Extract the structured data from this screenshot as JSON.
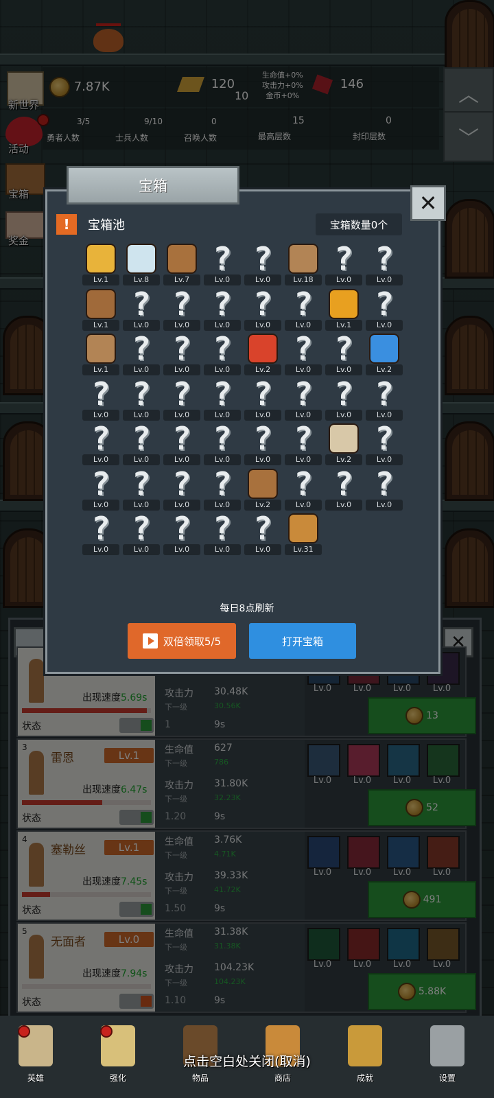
{
  "hud": {
    "world_label": "新世界",
    "activity_label": "活动",
    "chest_label": "宝箱",
    "reward_label": "奖金",
    "coins": "7.87K",
    "gold_bars": "120",
    "gold_bar_sub": "10",
    "gems": "146",
    "bonus_hp": "生命值+0%",
    "bonus_atk": "攻击力+0%",
    "bonus_gold": "金币+0%",
    "heroes_count": "3/5",
    "heroes_label": "勇者人数",
    "soldiers_count": "9/10",
    "soldiers_label": "士兵人数",
    "summon_count": "0",
    "summon_label": "召唤人数",
    "max_floor": "15",
    "max_floor_label": "最高层数",
    "sealed_floor": "0",
    "sealed_floor_label": "封印层数"
  },
  "modal": {
    "title": "宝箱",
    "pool_title": "宝箱池",
    "chest_count": "宝箱数量0个",
    "refresh_text": "每日8点刷新",
    "double_claim_label": "双倍领取5/5",
    "open_label": "打开宝箱"
  },
  "grid_items": [
    {
      "icon": "crown-icon",
      "lv": "Lv.1",
      "known": true,
      "color": "#e8b33a"
    },
    {
      "icon": "diamond-icon",
      "lv": "Lv.8",
      "known": true,
      "color": "#cfe4ee"
    },
    {
      "icon": "backpack-icon",
      "lv": "Lv.7",
      "known": true,
      "color": "#a8713d"
    },
    {
      "icon": "unknown-icon",
      "lv": "Lv.0",
      "known": false
    },
    {
      "icon": "unknown-icon",
      "lv": "Lv.0",
      "known": false
    },
    {
      "icon": "sword-icon",
      "lv": "Lv.18",
      "known": true,
      "color": "#b28455"
    },
    {
      "icon": "unknown-icon",
      "lv": "Lv.0",
      "known": false
    },
    {
      "icon": "unknown-icon",
      "lv": "Lv.0",
      "known": false
    },
    {
      "icon": "boot-icon",
      "lv": "Lv.1",
      "known": true,
      "color": "#a06a3a"
    },
    {
      "icon": "unknown-icon",
      "lv": "Lv.0",
      "known": false
    },
    {
      "icon": "unknown-icon",
      "lv": "Lv.0",
      "known": false
    },
    {
      "icon": "unknown-icon",
      "lv": "Lv.0",
      "known": false
    },
    {
      "icon": "unknown-icon",
      "lv": "Lv.0",
      "known": false
    },
    {
      "icon": "unknown-icon",
      "lv": "Lv.0",
      "known": false
    },
    {
      "icon": "torch-icon",
      "lv": "Lv.1",
      "known": true,
      "color": "#e8a020"
    },
    {
      "icon": "unknown-icon",
      "lv": "Lv.0",
      "known": false
    },
    {
      "icon": "dagger-icon",
      "lv": "Lv.1",
      "known": true,
      "color": "#b28455"
    },
    {
      "icon": "unknown-icon",
      "lv": "Lv.0",
      "known": false
    },
    {
      "icon": "unknown-icon",
      "lv": "Lv.0",
      "known": false
    },
    {
      "icon": "unknown-icon",
      "lv": "Lv.0",
      "known": false
    },
    {
      "icon": "red-potion-icon",
      "lv": "Lv.2",
      "known": true,
      "color": "#d9432b"
    },
    {
      "icon": "unknown-icon",
      "lv": "Lv.0",
      "known": false
    },
    {
      "icon": "unknown-icon",
      "lv": "Lv.0",
      "known": false
    },
    {
      "icon": "blue-potion-icon",
      "lv": "Lv.2",
      "known": true,
      "color": "#3a8fe0"
    },
    {
      "icon": "unknown-icon",
      "lv": "Lv.0",
      "known": false
    },
    {
      "icon": "unknown-icon",
      "lv": "Lv.0",
      "known": false
    },
    {
      "icon": "unknown-icon",
      "lv": "Lv.0",
      "known": false
    },
    {
      "icon": "unknown-icon",
      "lv": "Lv.0",
      "known": false
    },
    {
      "icon": "unknown-icon",
      "lv": "Lv.0",
      "known": false
    },
    {
      "icon": "unknown-icon",
      "lv": "Lv.0",
      "known": false
    },
    {
      "icon": "unknown-icon",
      "lv": "Lv.0",
      "known": false
    },
    {
      "icon": "unknown-icon",
      "lv": "Lv.0",
      "known": false
    },
    {
      "icon": "unknown-icon",
      "lv": "Lv.0",
      "known": false
    },
    {
      "icon": "unknown-icon",
      "lv": "Lv.0",
      "known": false
    },
    {
      "icon": "unknown-icon",
      "lv": "Lv.0",
      "known": false
    },
    {
      "icon": "unknown-icon",
      "lv": "Lv.0",
      "known": false
    },
    {
      "icon": "unknown-icon",
      "lv": "Lv.0",
      "known": false
    },
    {
      "icon": "unknown-icon",
      "lv": "Lv.0",
      "known": false
    },
    {
      "icon": "bread-icon",
      "lv": "Lv.2",
      "known": true,
      "color": "#d8c8a8"
    },
    {
      "icon": "unknown-icon",
      "lv": "Lv.0",
      "known": false
    },
    {
      "icon": "unknown-icon",
      "lv": "Lv.0",
      "known": false
    },
    {
      "icon": "unknown-icon",
      "lv": "Lv.0",
      "known": false
    },
    {
      "icon": "unknown-icon",
      "lv": "Lv.0",
      "known": false
    },
    {
      "icon": "unknown-icon",
      "lv": "Lv.0",
      "known": false
    },
    {
      "icon": "leather-armor-icon",
      "lv": "Lv.2",
      "known": true,
      "color": "#a8713d"
    },
    {
      "icon": "unknown-icon",
      "lv": "Lv.0",
      "known": false
    },
    {
      "icon": "unknown-icon",
      "lv": "Lv.0",
      "known": false
    },
    {
      "icon": "unknown-icon",
      "lv": "Lv.0",
      "known": false
    },
    {
      "icon": "unknown-icon",
      "lv": "Lv.0",
      "known": false
    },
    {
      "icon": "unknown-icon",
      "lv": "Lv.0",
      "known": false
    },
    {
      "icon": "unknown-icon",
      "lv": "Lv.0",
      "known": false
    },
    {
      "icon": "unknown-icon",
      "lv": "Lv.0",
      "known": false
    },
    {
      "icon": "unknown-icon",
      "lv": "Lv.0",
      "known": false
    },
    {
      "icon": "beer-mug-icon",
      "lv": "Lv.31",
      "known": true,
      "color": "#c98a3a"
    }
  ],
  "heroes": [
    {
      "index": "",
      "name": "",
      "level": "",
      "speed_label": "出现速度",
      "speed": "5.69s",
      "hp_fraction": 0.97,
      "status_label": "状态",
      "toggle_on": true,
      "hp_label": "",
      "hp": "",
      "hp_next_label": "",
      "hp_next": "",
      "atk_label": "攻击力",
      "atk": "30.48K",
      "atk_next_label": "下一级",
      "atk_next": "30.56K",
      "rate": "1",
      "time": "9s",
      "skills": [
        {
          "lv": "Lv.0",
          "color": "#2a4a6a"
        },
        {
          "lv": "Lv.0",
          "color": "#7a2a3a"
        },
        {
          "lv": "Lv.0",
          "color": "#2a4a6a"
        },
        {
          "lv": "Lv.0",
          "color": "#3a2a4a"
        }
      ],
      "cost": "13"
    },
    {
      "index": "3",
      "name": "雷恩",
      "level": "Lv.1",
      "speed_label": "出现速度",
      "speed": "6.47s",
      "hp_fraction": 0.62,
      "status_label": "状态",
      "toggle_on": true,
      "hp_label": "生命值",
      "hp": "627",
      "hp_next_label": "下一级",
      "hp_next": "786",
      "atk_label": "攻击力",
      "atk": "31.80K",
      "atk_next_label": "下一级",
      "atk_next": "32.23K",
      "rate": "1.20",
      "time": "9s",
      "skills": [
        {
          "lv": "Lv.0",
          "color": "#3a5a7a"
        },
        {
          "lv": "Lv.0",
          "color": "#b03a5a"
        },
        {
          "lv": "Lv.0",
          "color": "#2a6a8a"
        },
        {
          "lv": "Lv.0",
          "color": "#2a6a3a"
        }
      ],
      "cost": "52"
    },
    {
      "index": "4",
      "name": "塞勒丝",
      "level": "Lv.1",
      "speed_label": "出现速度",
      "speed": "7.45s",
      "hp_fraction": 0.22,
      "status_label": "状态",
      "toggle_on": true,
      "hp_label": "生命值",
      "hp": "3.76K",
      "hp_next_label": "下一级",
      "hp_next": "4.71K",
      "atk_label": "攻击力",
      "atk": "39.33K",
      "atk_next_label": "下一级",
      "atk_next": "41.72K",
      "rate": "1.50",
      "time": "9s",
      "skills": [
        {
          "lv": "Lv.0",
          "color": "#2a4a7a"
        },
        {
          "lv": "Lv.0",
          "color": "#8a2a3a"
        },
        {
          "lv": "Lv.0",
          "color": "#2a5a8a"
        },
        {
          "lv": "Lv.0",
          "color": "#8a3a2a"
        }
      ],
      "cost": "491"
    },
    {
      "index": "5",
      "name": "无面者",
      "level": "Lv.0",
      "speed_label": "出现速度",
      "speed": "7.94s",
      "hp_fraction": 0,
      "status_label": "状态",
      "toggle_on": false,
      "hp_label": "生命值",
      "hp": "31.38K",
      "hp_next_label": "下一级",
      "hp_next": "31.38K",
      "atk_label": "攻击力",
      "atk": "104.23K",
      "atk_next_label": "下一级",
      "atk_next": "104.23K",
      "rate": "1.10",
      "time": "9s",
      "skills": [
        {
          "lv": "Lv.0",
          "color": "#1f5a3a"
        },
        {
          "lv": "Lv.0",
          "color": "#8a2a2a"
        },
        {
          "lv": "Lv.0",
          "color": "#1f6a8a"
        },
        {
          "lv": "Lv.0",
          "color": "#7a5a2a"
        }
      ],
      "cost": "5.88K"
    }
  ],
  "nav": [
    {
      "label": "英雄",
      "icon": "skull-icon",
      "color": "#c9b58a",
      "dot": true
    },
    {
      "label": "强化",
      "icon": "candle-icon",
      "color": "#d8c07a",
      "dot": true
    },
    {
      "label": "物品",
      "icon": "book-icon",
      "color": "#6a4a2a",
      "dot": false
    },
    {
      "label": "商店",
      "icon": "beer-mug-icon",
      "color": "#c98a3a",
      "dot": false
    },
    {
      "label": "成就",
      "icon": "key-icon",
      "color": "#c99a3a",
      "dot": false
    },
    {
      "label": "设置",
      "icon": "gear-icon",
      "color": "#9aa0a3",
      "dot": false
    }
  ],
  "hint": "点击空白处关闭(取消)",
  "colors": {
    "accent_orange": "#e0682a",
    "accent_blue": "#2f8fe0",
    "buy_green": "#2c9a3a",
    "toggle_on": "#2c9a3a",
    "toggle_off": "#d0551f"
  }
}
